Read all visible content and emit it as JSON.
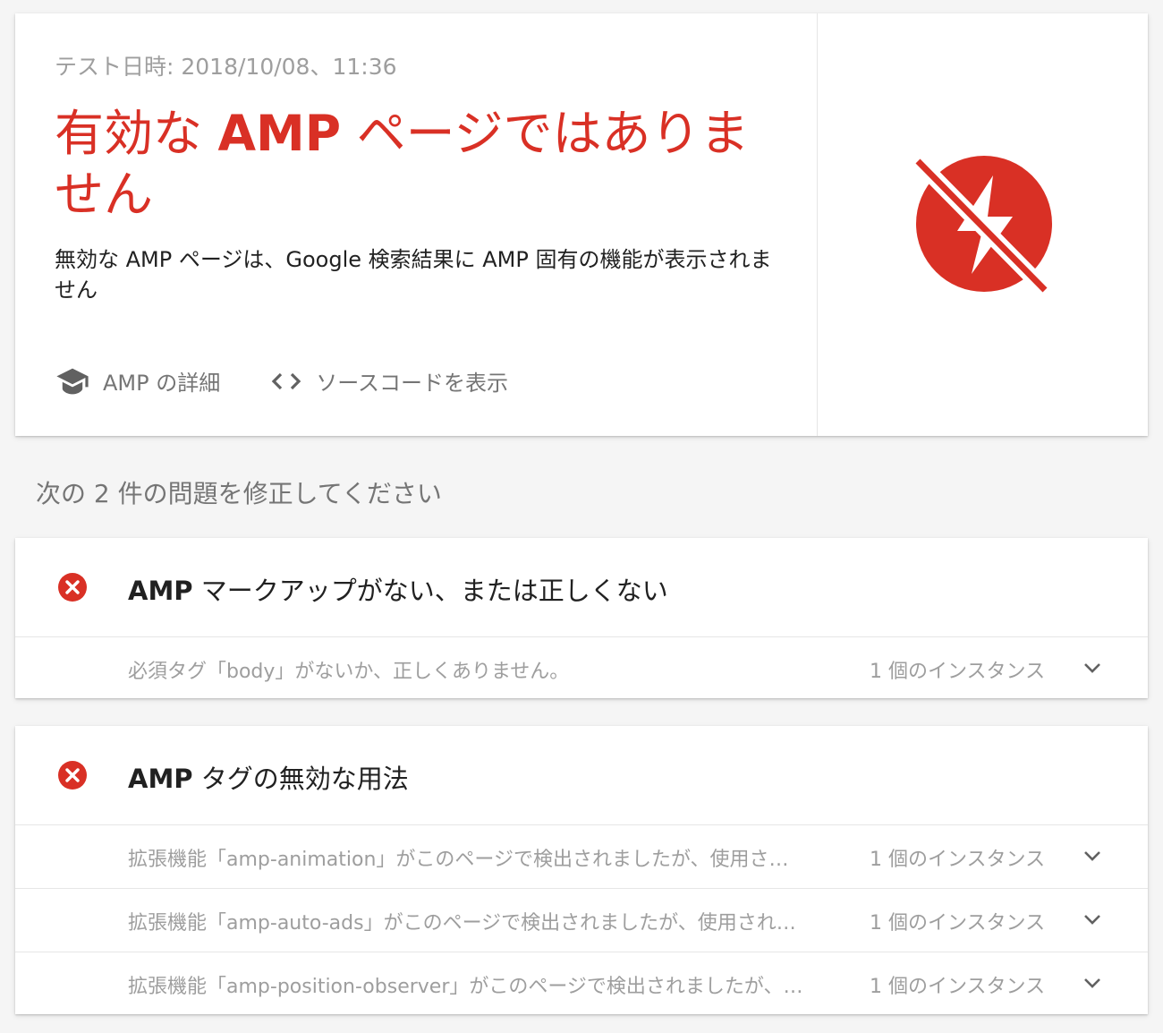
{
  "summary": {
    "test_date": "テスト日時: 2018/10/08、11:36",
    "headline_pre": "有効な ",
    "headline_bold": "AMP",
    "headline_post": " ページではありません",
    "subtitle": "無効な AMP ページは、Google 検索結果に AMP 固有の機能が表示されません",
    "link_amp_details": "AMP の詳細",
    "link_view_source": "ソースコードを表示",
    "status_icon": "amp-invalid-icon",
    "colors": {
      "error": "#d93025",
      "muted": "#9e9e9e",
      "text": "#212121"
    }
  },
  "section_title": "次の 2 件の問題を修正してください",
  "issues": [
    {
      "title_bold": "AMP",
      "title_rest": " マークアップがない、または正しくない",
      "icon": "error-circle-icon",
      "rows": [
        {
          "desc": "必須タグ「body」がないか、正しくありません。",
          "count": "1 個のインスタンス"
        }
      ]
    },
    {
      "title_bold": "AMP",
      "title_rest": " タグの無効な用法",
      "icon": "error-circle-icon",
      "rows": [
        {
          "desc": "拡張機能「amp-animation」がこのページで検出されましたが、使用さ…",
          "count": "1 個のインスタンス"
        },
        {
          "desc": "拡張機能「amp-auto-ads」がこのページで検出されましたが、使用され…",
          "count": "1 個のインスタンス"
        },
        {
          "desc": "拡張機能「amp-position-observer」がこのページで検出されましたが、…",
          "count": "1 個のインスタンス"
        }
      ]
    }
  ]
}
